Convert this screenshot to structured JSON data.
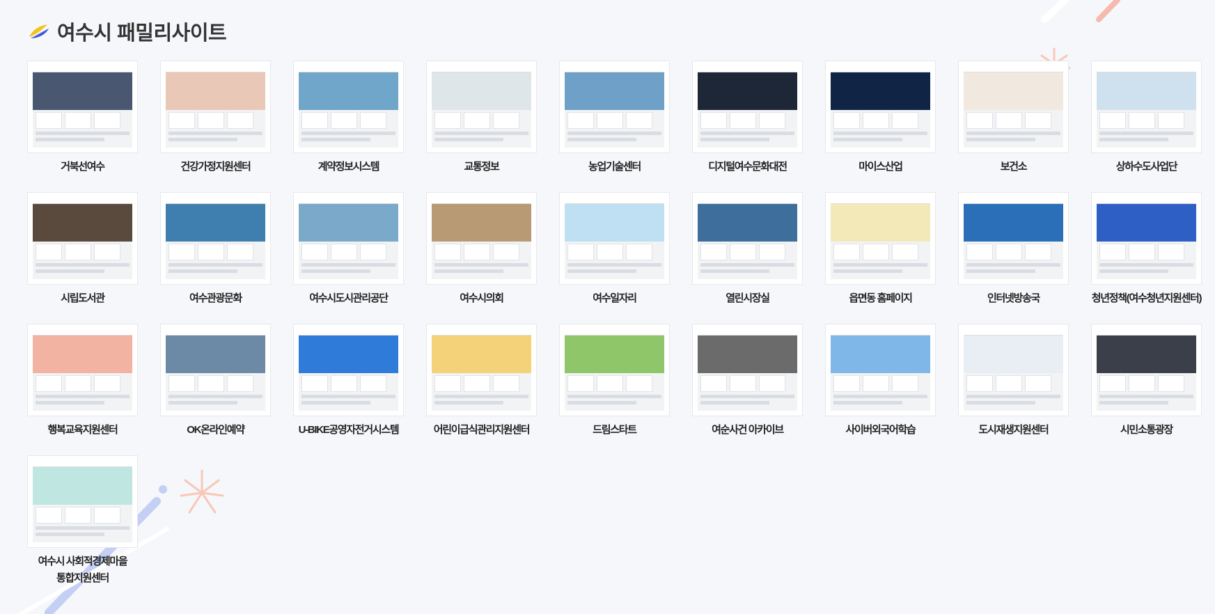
{
  "header": {
    "title": "여수시 패밀리사이트"
  },
  "colors": {
    "accent_blue": "#3d5bd6",
    "accent_yellow": "#f4c21a",
    "deco_pink": "#f7b5a7"
  },
  "sites": [
    {
      "label": "거북선여수",
      "hero": "#4a5770"
    },
    {
      "label": "건강가정지원센터",
      "hero": "#e9c8b8"
    },
    {
      "label": "계약정보시스템",
      "hero": "#6fa6c9"
    },
    {
      "label": "교통정보",
      "hero": "#dfe6ea"
    },
    {
      "label": "농업기술센터",
      "hero": "#6fa0c8"
    },
    {
      "label": "디지털여수문화대전",
      "hero": "#1d2738"
    },
    {
      "label": "마이스산업",
      "hero": "#102445"
    },
    {
      "label": "보건소",
      "hero": "#f1e9df"
    },
    {
      "label": "상하수도사업단",
      "hero": "#cfe1ef"
    },
    {
      "label": "시립도서관",
      "hero": "#5a4a3d"
    },
    {
      "label": "여수관광문화",
      "hero": "#3f7fb0"
    },
    {
      "label": "여수시도시관리공단",
      "hero": "#7aa9c9"
    },
    {
      "label": "여수시의회",
      "hero": "#b89a74"
    },
    {
      "label": "여수일자리",
      "hero": "#bfe0f2"
    },
    {
      "label": "열린시장실",
      "hero": "#3d6e9c"
    },
    {
      "label": "읍면동 홈페이지",
      "hero": "#f3e9b8"
    },
    {
      "label": "인터넷방송국",
      "hero": "#2a6fb8"
    },
    {
      "label": "청년정책(여수청년지원센터)",
      "hero": "#2d5fc4"
    },
    {
      "label": "행복교육지원센터",
      "hero": "#f2b3a2"
    },
    {
      "label": "OK온라인예약",
      "hero": "#6c8aa6"
    },
    {
      "label": "U-BIKE공영자전거시스템",
      "hero": "#2f7bd9"
    },
    {
      "label": "어린이급식관리지원센터",
      "hero": "#f4d27a"
    },
    {
      "label": "드림스타트",
      "hero": "#8fc66a"
    },
    {
      "label": "여순사건 아카이브",
      "hero": "#6b6b6b"
    },
    {
      "label": "사이버외국어학습",
      "hero": "#7fb7e8"
    },
    {
      "label": "도시재생지원센터",
      "hero": "#e9eef5"
    },
    {
      "label": "시민소통광장",
      "hero": "#3a3f4a"
    },
    {
      "label": "여수시 사회적경제마을\n통합지원센터",
      "hero": "#bfe6e0"
    }
  ]
}
